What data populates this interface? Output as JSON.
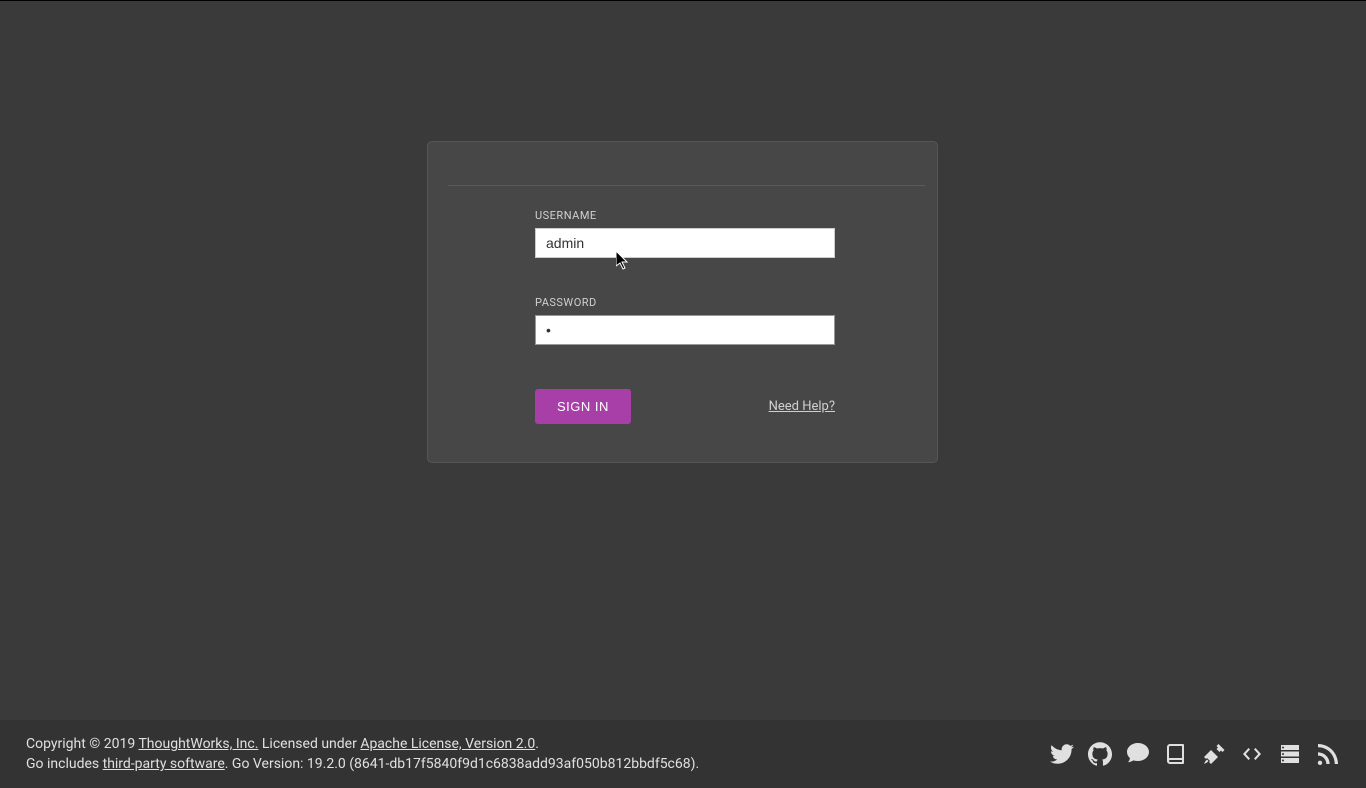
{
  "form": {
    "username_label": "USERNAME",
    "username_value": "admin",
    "password_label": "PASSWORD",
    "password_value": "•",
    "signin_label": "SIGN IN",
    "help_label": "Need Help?"
  },
  "footer": {
    "copyright_prefix": "Copyright © 2019 ",
    "company": "ThoughtWorks, Inc.",
    "license_prefix": " Licensed under ",
    "license": "Apache License, Version 2.0",
    "license_suffix": ".",
    "go_includes_prefix": "Go includes ",
    "third_party": "third-party software",
    "version_text": ". Go Version: 19.2.0 (8641-db17f5840f9d1c6838add93af050b812bbdf5c68)."
  }
}
